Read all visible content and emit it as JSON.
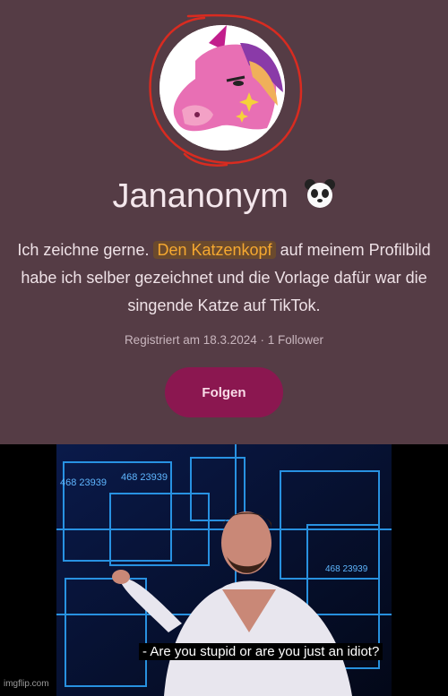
{
  "profile": {
    "display_name": "Jananonym",
    "name_emoji": "panda-face-icon",
    "bio": {
      "part1": "Ich zeichne gerne. ",
      "highlight": "Den Katzenkopf",
      "part2": " auf meinem Profilbild habe ich selber gezeichnet und die Vorlage dafür war die singende Katze auf TikTok."
    },
    "meta": "Registriert am 18.3.2024 · 1 Follower",
    "follow_button": "Folgen",
    "avatar": "unicorn-drawing",
    "colors": {
      "background": "#553c45",
      "follow_button": "#8b1750",
      "highlight_text": "#f5a830",
      "scribble": "#d92b20"
    }
  },
  "meme": {
    "caption": "- Are you stupid or are you just an idiot?",
    "screen_numbers": [
      "468 23939",
      "468 23939",
      "468 23939"
    ],
    "watermark": "imgflip.com"
  }
}
